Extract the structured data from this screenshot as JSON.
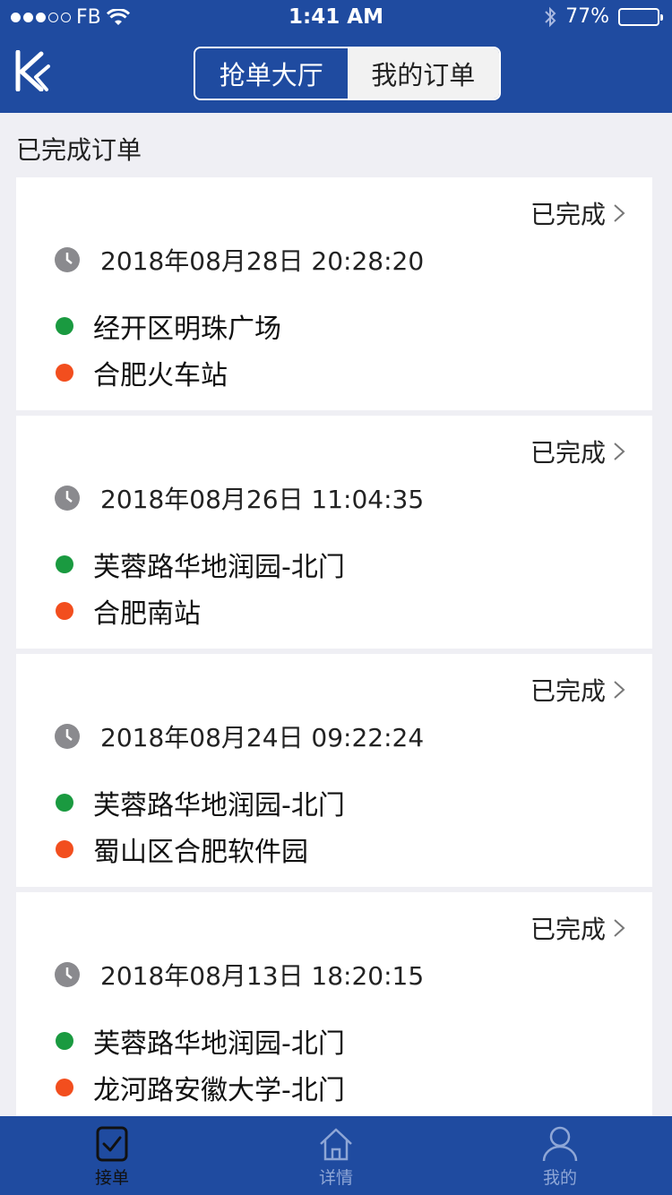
{
  "status_bar": {
    "carrier": "FB",
    "time": "1:41 AM",
    "battery": "77%",
    "battery_level": 0.77
  },
  "header": {
    "segments": [
      {
        "label": "抢单大厅",
        "active": true
      },
      {
        "label": "我的订单",
        "active": false
      }
    ]
  },
  "section_title": "已完成订单",
  "orders": [
    {
      "status": "已完成",
      "time": "2018年08月28日 20:28:20",
      "from": "经开区明珠广场",
      "to": "合肥火车站"
    },
    {
      "status": "已完成",
      "time": "2018年08月26日 11:04:35",
      "from": "芙蓉路华地润园-北门",
      "to": "合肥南站"
    },
    {
      "status": "已完成",
      "time": "2018年08月24日 09:22:24",
      "from": "芙蓉路华地润园-北门",
      "to": "蜀山区合肥软件园"
    },
    {
      "status": "已完成",
      "time": "2018年08月13日 18:20:15",
      "from": "芙蓉路华地润园-北门",
      "to": "龙河路安徽大学-北门"
    }
  ],
  "tabbar": {
    "tabs": [
      {
        "label": "接单",
        "icon": "clipboard-check-icon",
        "active": true
      },
      {
        "label": "详情",
        "icon": "home-icon",
        "active": false
      },
      {
        "label": "我的",
        "icon": "user-icon",
        "active": false
      }
    ]
  },
  "colors": {
    "brand_blue": "#1f4ba0",
    "origin_dot": "#1a9a40",
    "destination_dot": "#f24e1e"
  }
}
